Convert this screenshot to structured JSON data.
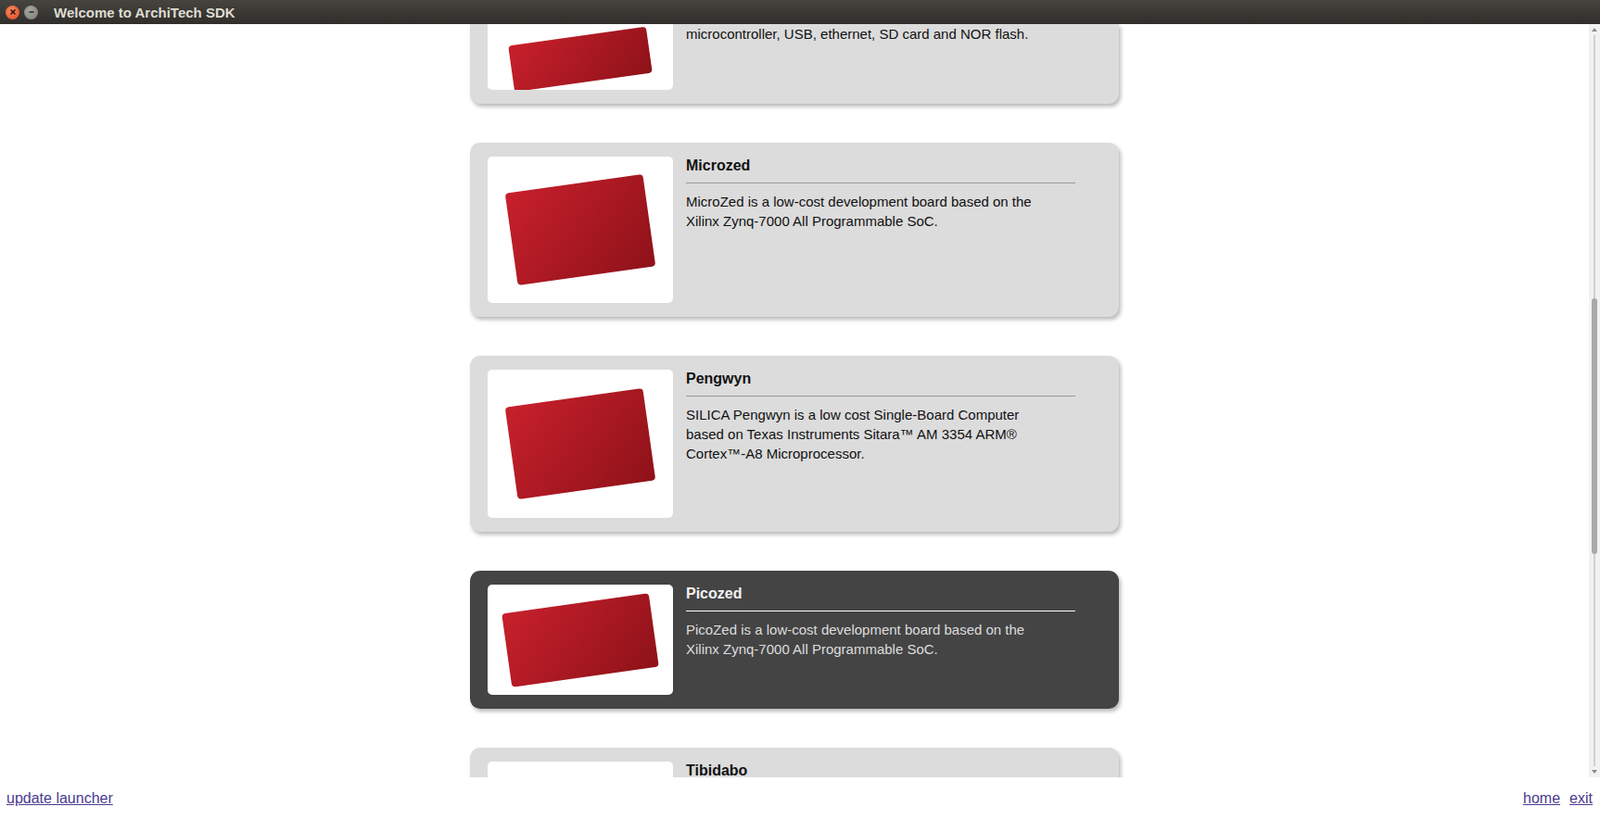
{
  "window": {
    "title": "Welcome to ArchiTech SDK"
  },
  "boards": [
    {
      "kind": "partial-top",
      "lines": [
        "microcontroller, USB, ethernet, SD card and NOR flash."
      ],
      "selected": false
    },
    {
      "kind": "full",
      "name": "Microzed",
      "lines": [
        "MicroZed is a low-cost development board based on the",
        "Xilinx Zynq-7000 All Programmable SoC."
      ],
      "selected": false
    },
    {
      "kind": "full",
      "name": "Pengwyn",
      "lines": [
        "SILICA Pengwyn is a low cost Single-Board Computer",
        "based on Texas Instruments Sitara™ AM 3354 ARM®",
        "Cortex™-A8 Microprocessor."
      ],
      "selected": false
    },
    {
      "kind": "full",
      "name": "Picozed",
      "lines": [
        "PicoZed is a low-cost development board based on the",
        "Xilinx Zynq-7000 All Programmable SoC."
      ],
      "selected": true
    },
    {
      "kind": "partial-bottom",
      "name": "Tibidabo",
      "lines": [],
      "selected": false
    }
  ],
  "scrollbar": {
    "offset": 0.36,
    "size": 0.35
  },
  "footer": {
    "left": [
      "update launcher"
    ],
    "right": [
      "home",
      "exit"
    ]
  }
}
